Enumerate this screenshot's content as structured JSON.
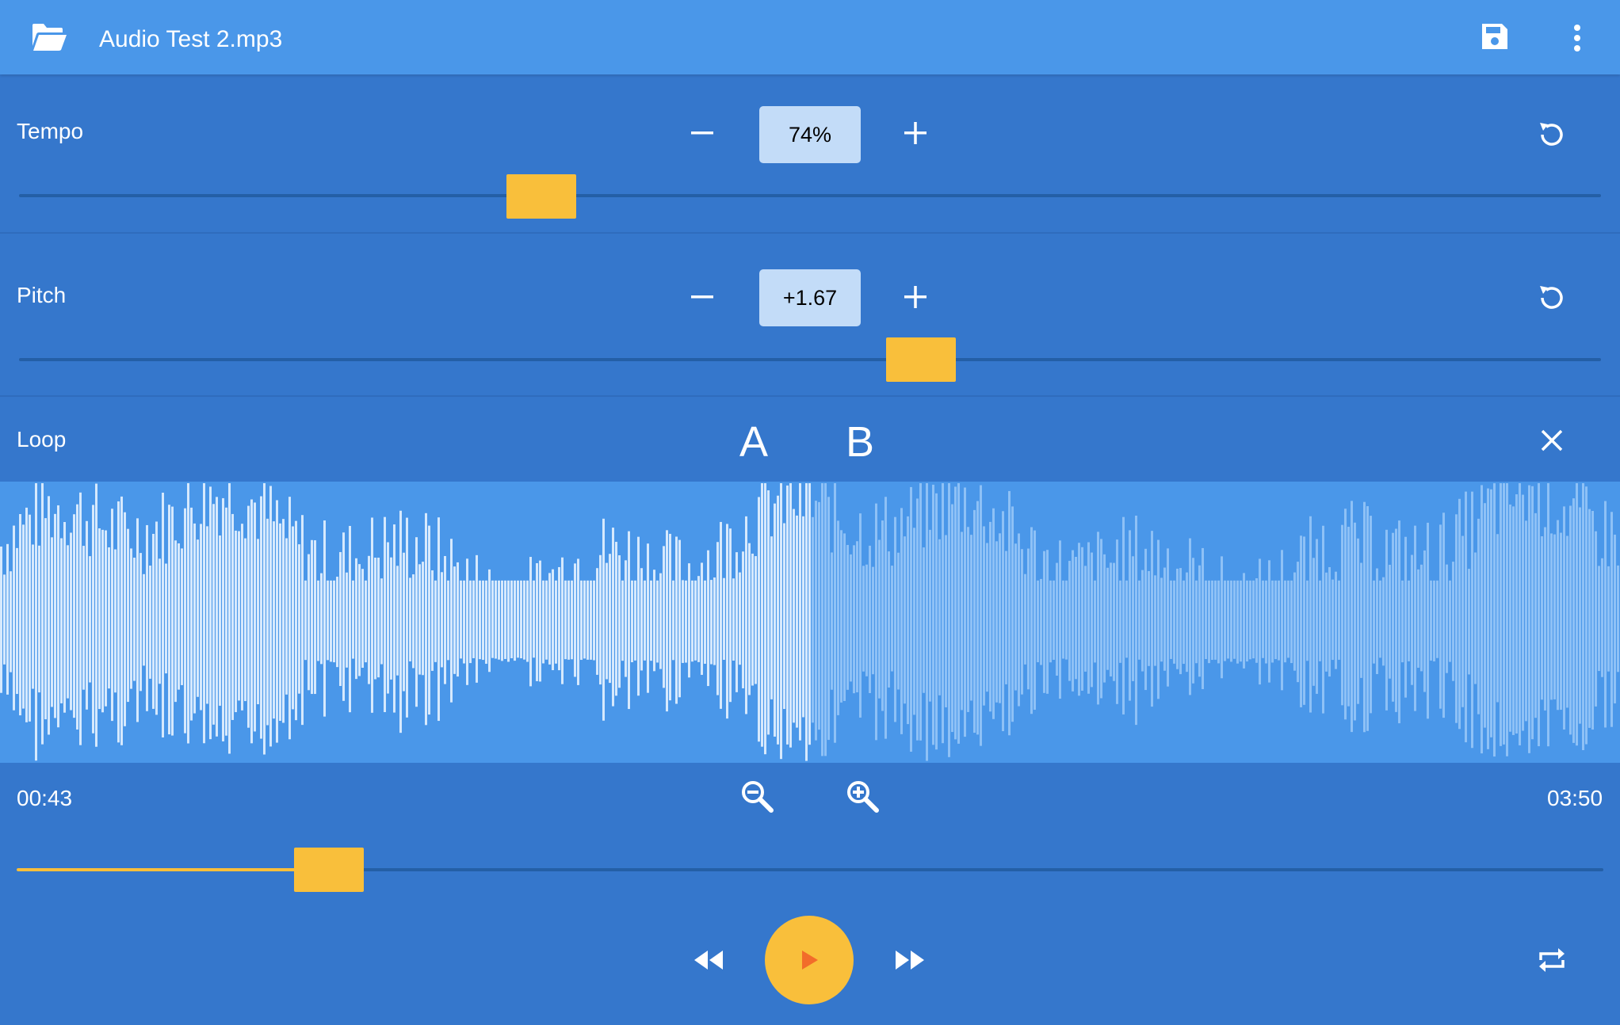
{
  "appbar": {
    "title": "Audio Test 2.mp3",
    "icons": {
      "open": "folder-open-icon",
      "save": "save-icon",
      "menu": "more-vert-icon"
    }
  },
  "tempo": {
    "label": "Tempo",
    "value": "74%",
    "slider_fraction": 0.33
  },
  "pitch": {
    "label": "Pitch",
    "value": "+1.67",
    "slider_fraction": 0.57
  },
  "loop": {
    "label": "Loop",
    "point_a": "A",
    "point_b": "B"
  },
  "waveform": {
    "played_fraction": 0.5
  },
  "playback": {
    "current_time": "00:43",
    "total_time": "03:50",
    "progress_fraction": 0.197
  },
  "colors": {
    "appbar": "#4a97e9",
    "background": "#3577cc",
    "accent": "#f9bf3b",
    "play_triangle": "#f26c2a",
    "wave_played": "#d6e9fd",
    "wave_unplayed": "#8ec1f6"
  }
}
